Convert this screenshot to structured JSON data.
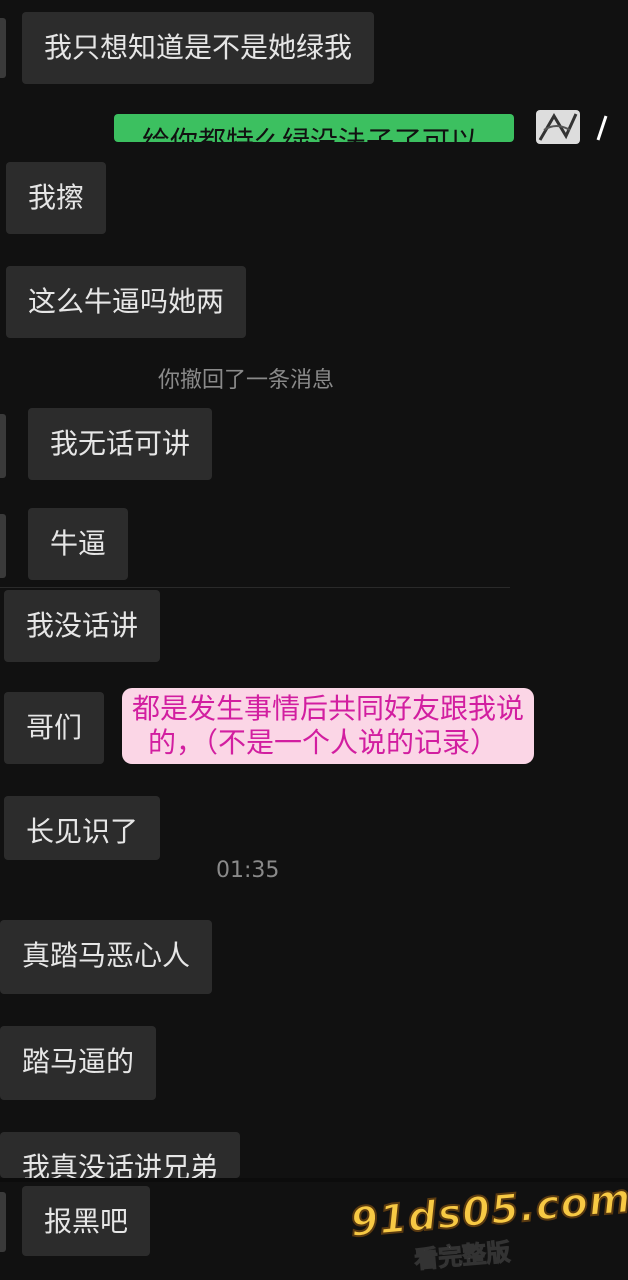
{
  "messages": {
    "m1": "我只想知道是不是她绿我",
    "m_green": "给你都特么绿没法子了可以",
    "m2": "我擦",
    "m3": "这么牛逼吗她两",
    "recall": "你撤回了一条消息",
    "m4": "我无话可讲",
    "m5": "牛逼",
    "m6": "我没话讲",
    "m7": "哥们",
    "m8": "长见识了",
    "time": "01:35",
    "m9": "真踏马恶心人",
    "m10": "踏马逼的",
    "m11": "我真没话讲兄弟",
    "m12": "报黑吧"
  },
  "annotation": {
    "line1": "都是发生事情后共同好友跟我说",
    "line2": "的，（不是一个人说的记录）"
  },
  "watermark": {
    "site": "91ds05.com",
    "sub": "看完整版"
  },
  "colors": {
    "background": "#111111",
    "incoming_bubble": "#2c2c2c",
    "outgoing_bubble": "#3cc060",
    "note_bg": "#fbd6e6",
    "note_text": "#d21ea0"
  }
}
